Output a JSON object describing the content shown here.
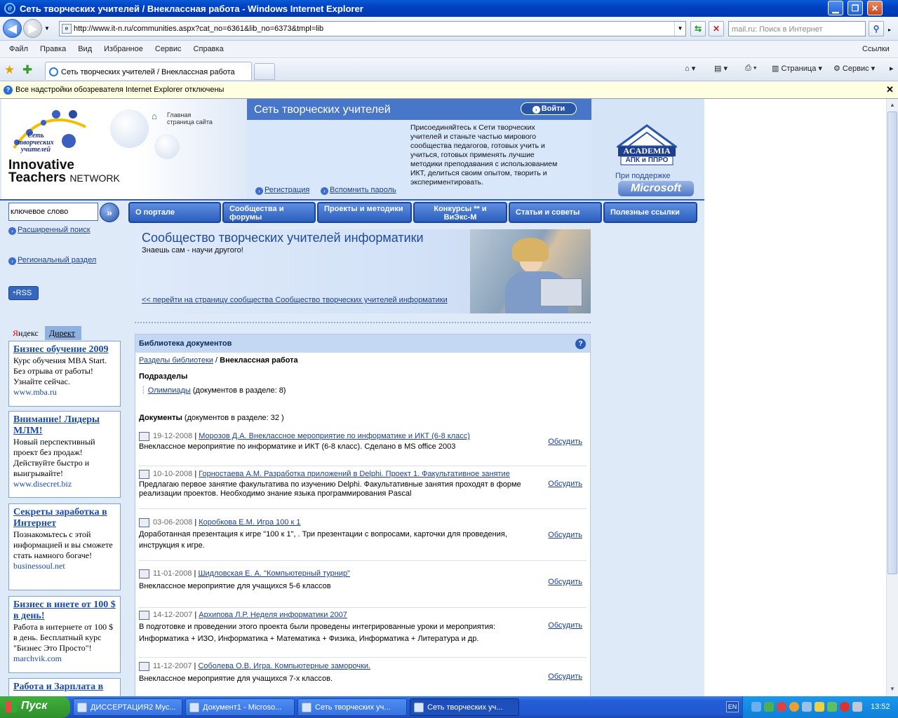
{
  "window": {
    "title": "Сеть творческих учителей / Внеклассная работа - Windows Internet Explorer"
  },
  "address": {
    "url": "http://www.it-n.ru/communities.aspx?cat_no=6361&lib_no=6373&tmpl=lib"
  },
  "search": {
    "placeholder": "mail.ru: Поиск в Интернет"
  },
  "menu": {
    "items": [
      "Файл",
      "Правка",
      "Вид",
      "Избранное",
      "Сервис",
      "Справка"
    ],
    "links": "Ссылки"
  },
  "tabbar": {
    "tab": "Сеть творческих учителей / Внеклассная работа",
    "page_label": "Страница",
    "service_label": "Сервис"
  },
  "infobar": {
    "text": "Все надстройки обозревателя Internet Explorer отключены"
  },
  "site": {
    "logo_text": {
      "line1": "Сеть",
      "line2": "творческих",
      "line3": "учителей"
    },
    "brand": {
      "line1": "Innovative",
      "line2a": "Teachers",
      "line2b": "NETWORK"
    },
    "home_link": {
      "line1": "Главная",
      "line2": "страница сайта"
    },
    "header_title": "Сеть творческих учителей",
    "login": "Войти",
    "join_text": "Присоединяйтесь к Сети творческих учителей и станьте частью мирового сообщества педагогов, готовых учить и учиться, готовых применять лучшие методики преподавания с использованием ИКТ, делиться своим опытом, творить и экспериментировать.",
    "register": "Регистрация",
    "remind": "Вспомнить пароль",
    "academia": {
      "name": "ACADEMIA",
      "sub": "АПК и ППРО"
    },
    "support": "При поддержке",
    "microsoft": "Microsoft",
    "search_value": "ключевое слово",
    "adv_search": "Расширенный поиск",
    "regional": "Региональный раздел",
    "rss": "RSS",
    "nav": [
      {
        "label": "О портале"
      },
      {
        "label": "Сообщества и форумы"
      },
      {
        "label": "Проекты и методики"
      },
      {
        "label": "Конкурсы ** и ВиЭкс-М"
      },
      {
        "label": "Статьи и советы"
      },
      {
        "label": "Полезные ссылки"
      }
    ],
    "banner": {
      "title": "Сообщество творческих учителей информатики",
      "subtitle": "Знаешь сам - научи другого!",
      "link": "<< перейти на страницу сообщества Сообщество творческих учителей информатики"
    },
    "library": {
      "title": "Библиотека документов",
      "breadcrumb_link": "Разделы библиотеки",
      "breadcrumb_sep": " / ",
      "breadcrumb_current": "Внеклассная работа",
      "subsections_title": "Подразделы",
      "subsection_link": "Олимпиады",
      "subsection_count": "(документов в разделе: 8)",
      "documents_title": "Документы",
      "documents_count": "(документов в разделе: 32 )",
      "discuss": "Обсудить",
      "docs": [
        {
          "date": "19-12-2008",
          "title": "Морозов Д.А. Внеклассное мероприятие по информатике и ИКТ (6-8 класс)",
          "desc": "Внеклассное мероприятие по информатике и ИКТ (6-8 класс). Сделано в MS office 2003"
        },
        {
          "date": "10-10-2008",
          "title": "Горностаева А.М. Разработка приложений в Delphi. Проект 1. Факультативное занятие",
          "desc": "Предлагаю первое занятие факультатива по изучению Delphi. Факультативные занятия проходят в форме реализации проектов. Необходимо знание языка программирования Pascal"
        },
        {
          "date": "03-06-2008",
          "title": "Коробкова Е.М. Игра 100 к 1",
          "desc": "Доработанная презентация к игре \"100 к 1\", . Три презентации с вопросами, карточки для проведения, инструкция к игре."
        },
        {
          "date": "11-01-2008",
          "title": "Шидловская Е. А. \"Компьютерный турнир\"",
          "desc": "Внеклассное мероприятие для учащихся 5-6 классов"
        },
        {
          "date": "14-12-2007",
          "title": "Архипова Л.Р. Неделя информатики 2007",
          "desc": "В подготовке и проведении этого проекта были проведены интегрированные уроки и мероприятия: Информатика + ИЗО, Информатика + Математика + Физика, Информатика + Литература и др."
        },
        {
          "date": "11-12-2007",
          "title": "Соболева О.В. Игра. Компьютерные заморочки.",
          "desc": "Внеклассное мероприятие для учащихся 7-х классов."
        }
      ]
    },
    "ads_tabs": {
      "yandex_red": "Я",
      "yandex_rest": "ндекс",
      "direct": "Директ"
    },
    "ads": [
      {
        "title": "Бизнес обучение 2009",
        "text": "Курс обучения MBA Start. Без отрыва от работы! Узнайте сейчас.",
        "url": "www.mba.ru"
      },
      {
        "title": "Внимание! Лидеры МЛМ!",
        "text": "Новый перспективный проект без продаж! Действуйте быстро и выигрывайте!",
        "url": "www.disecret.biz"
      },
      {
        "title": "Секреты заработка в Интернет",
        "text": "Познакомьтесь с этой информацией и вы сможете стать намного богаче!",
        "url": "businessoul.net"
      },
      {
        "title": "Бизнес в инете от 100 $ в день!",
        "text": "Работа в интернете от 100 $ в день. Бесплатный курс \"Бизнес Это Просто\"!",
        "url": "marchvik.com"
      },
      {
        "title": "Работа и Зарплата в",
        "text": "",
        "url": ""
      }
    ]
  },
  "taskbar": {
    "start": "Пуск",
    "tasks": [
      "ДИССЕРТАЦИЯ2 Mус...",
      "Документ1 - Microso...",
      "Сеть творческих уч...",
      "Сеть творческих уч..."
    ],
    "lang": "EN",
    "clock": "13:52"
  }
}
